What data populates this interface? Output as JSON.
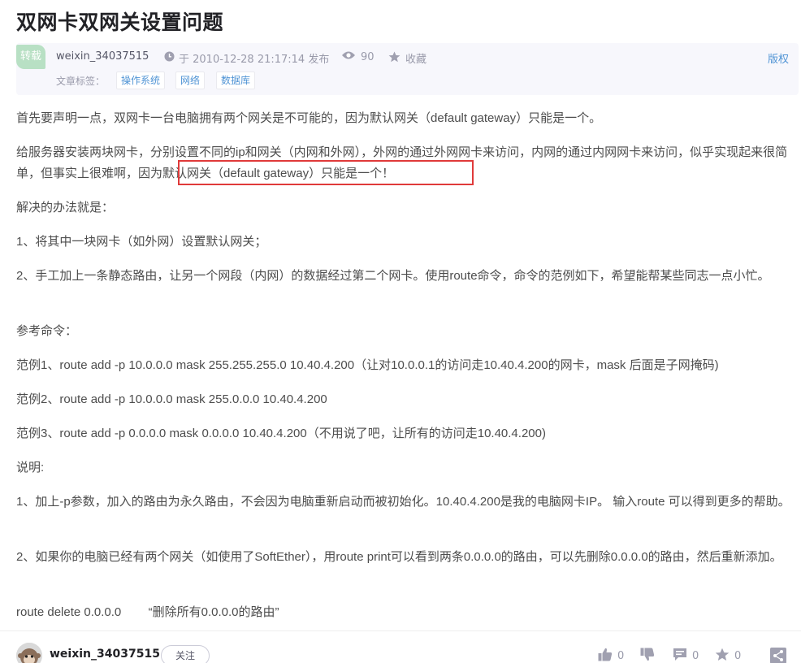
{
  "article": {
    "title": "双网卡双网关设置问题",
    "repost_badge": "转载",
    "author": "weixin_34037515",
    "publish_time": "于 2010-12-28 21:17:14 发布",
    "views": "90",
    "favorite_label": "收藏",
    "copyright_label": "版权",
    "tags_label": "文章标签：",
    "tags": [
      "操作系统",
      "网络",
      "数据库"
    ],
    "paragraphs": [
      "首先要声明一点，双网卡一台电脑拥有两个网关是不可能的，因为默认网关（default gateway）只能是一个。",
      "给服务器安装两块网卡，分别设置不同的ip和网关（内网和外网），外网的通过外网网卡来访问，内网的通过内网网卡来访问，似乎实现起来很简单，但事实上很难啊，因为默认网关（default gateway）只能是一个！",
      "解决的办法就是：",
      "1、将其中一块网卡（如外网）设置默认网关；",
      "2、手工加上一条静态路由，让另一个网段（内网）的数据经过第二个网卡。使用route命令，命令的范例如下，希望能帮某些同志一点小忙。",
      "参考命令：",
      "范例1、route add -p 10.0.0.0 mask 255.255.255.0 10.40.4.200（让对10.0.0.1的访问走10.40.4.200的网卡，mask 后面是子网掩码)",
      "范例2、route add -p 10.0.0.0 mask 255.0.0.0 10.40.4.200",
      "范例3、route add -p 0.0.0.0 mask 0.0.0.0 10.40.4.200（不用说了吧，让所有的访问走10.40.4.200)",
      "说明:",
      "1、加上-p参数，加入的路由为永久路由，不会因为电脑重新启动而被初始化。10.40.4.200是我的电脑网卡IP。 输入route 可以得到更多的帮助。",
      "2、如果你的电脑已经有两个网关（如使用了SoftEther），用route print可以看到两条0.0.0.0的路由，可以先删除0.0.0.0的路由，然后重新添加。",
      "route delete 0.0.0.0        “删除所有0.0.0.0的路由”"
    ]
  },
  "bottom_bar": {
    "author": "weixin_34037515",
    "follow_label": "关注",
    "like_count": "0",
    "comment_count": "0",
    "collect_count": "0"
  },
  "colors": {
    "accent_link": "#5094d5",
    "highlight_border": "#e03a3a",
    "repost_badge_bg": "#b8e0c4"
  }
}
